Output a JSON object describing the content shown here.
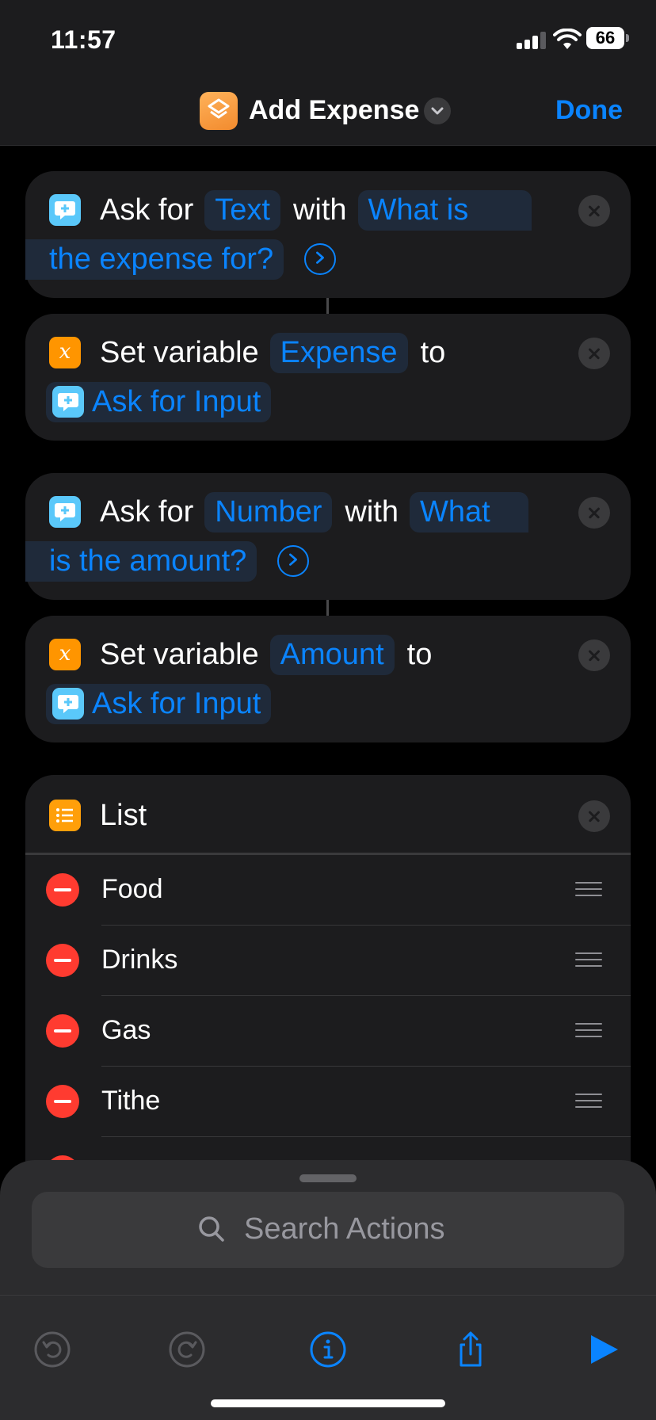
{
  "status_bar": {
    "time": "11:57",
    "battery": "66"
  },
  "nav": {
    "title": "Add Expense",
    "done_label": "Done"
  },
  "actions": [
    {
      "type": "ask",
      "prefix": "Ask for",
      "input_type": "Text",
      "connector": "with",
      "prompt_line1": "What is",
      "prompt_line2": "the expense for?"
    },
    {
      "type": "set_variable",
      "prefix": "Set variable",
      "variable": "Expense",
      "connector": "to",
      "value": "Ask for Input"
    },
    {
      "type": "ask",
      "prefix": "Ask for",
      "input_type": "Number",
      "connector": "with",
      "prompt_line1": "What",
      "prompt_line2": "is the amount?"
    },
    {
      "type": "set_variable",
      "prefix": "Set variable",
      "variable": "Amount",
      "connector": "to",
      "value": "Ask for Input"
    }
  ],
  "list": {
    "title": "List",
    "items": [
      "Food",
      "Drinks",
      "Gas",
      "Tithe"
    ]
  },
  "search": {
    "placeholder": "Search Actions"
  },
  "toolbar": {
    "icons": [
      "undo-icon",
      "redo-icon",
      "info-icon",
      "share-icon",
      "play-icon"
    ]
  },
  "colors": {
    "accent": "#0a84ff",
    "card": "#1c1c1e",
    "delete": "#ff3b30",
    "app_icon": "#f7a04a"
  }
}
